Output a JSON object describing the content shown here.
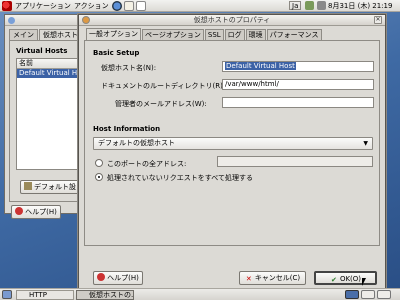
{
  "top_panel": {
    "menus": [
      "アプリケーション",
      "アクション"
    ],
    "input_method": "Ja",
    "clock": "8月31日 (木) 21:19"
  },
  "bg_window": {
    "tabs": [
      "メイン",
      "仮想ホスト",
      "サ"
    ],
    "section_title": "Virtual Hosts",
    "column_header": "名前",
    "selected_item": "Default Virtual Ho",
    "default_button": "デフォルト設",
    "help_button": "ヘルプ(H)"
  },
  "dialog": {
    "title": "仮想ホストのプロパティ",
    "tabs": [
      "一般オプション",
      "ページオプション",
      "SSL",
      "ログ",
      "環境",
      "パフォーマンス"
    ],
    "basic_setup": {
      "heading": "Basic Setup",
      "vhost_name_label": "仮想ホスト名(N):",
      "vhost_name_value": "Default Virtual Host",
      "docroot_label": "ドキュメントのルートディレクトリ(R):",
      "docroot_value": "/var/www/html/",
      "admin_email_label": "管理者のメールアドレス(W):",
      "admin_email_value": ""
    },
    "host_info": {
      "heading": "Host Information",
      "combo_value": "デフォルトの仮想ホスト",
      "radio_all_addresses": "このポートの全アドレス:",
      "radio_unhandled": "処理されていないリクエストをすべて処理する"
    },
    "buttons": {
      "help": "ヘルプ(H)",
      "cancel": "キャンセル(C)",
      "ok": "OK(O)"
    }
  },
  "taskbar": {
    "items": [
      "HTTP",
      "仮想ホストの..."
    ]
  },
  "colors": {
    "selection": "#3c62a6",
    "desktop": "#3f6aa4"
  }
}
